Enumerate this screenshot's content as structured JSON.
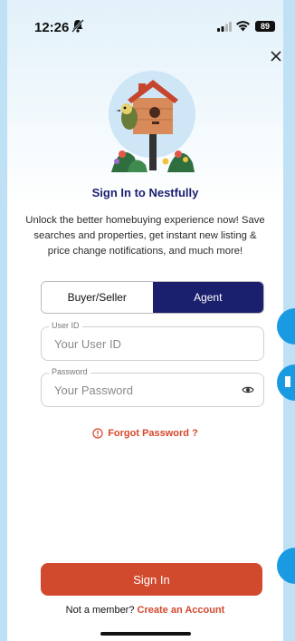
{
  "status_bar": {
    "time": "12:26",
    "battery": "89"
  },
  "header": {
    "close_icon": "close-icon"
  },
  "title": "Sign In to Nestfully",
  "description": "Unlock the better homebuying experience now! Save searches and properties, get instant new listing & price change notifications, and much more!",
  "segment": {
    "buyer_label": "Buyer/Seller",
    "agent_label": "Agent",
    "selected": "Agent"
  },
  "user_id": {
    "label": "User ID",
    "placeholder": "Your User ID",
    "value": ""
  },
  "password": {
    "label": "Password",
    "placeholder": "Your Password",
    "value": ""
  },
  "forgot_password": "Forgot Password ?",
  "sign_in_label": "Sign In",
  "footer": {
    "prompt": "Not a member?",
    "link": "Create an Account"
  },
  "colors": {
    "primary_navy": "#1a1f6e",
    "accent_orange": "#d24a2e",
    "side_bubble": "#1a9ae3"
  }
}
